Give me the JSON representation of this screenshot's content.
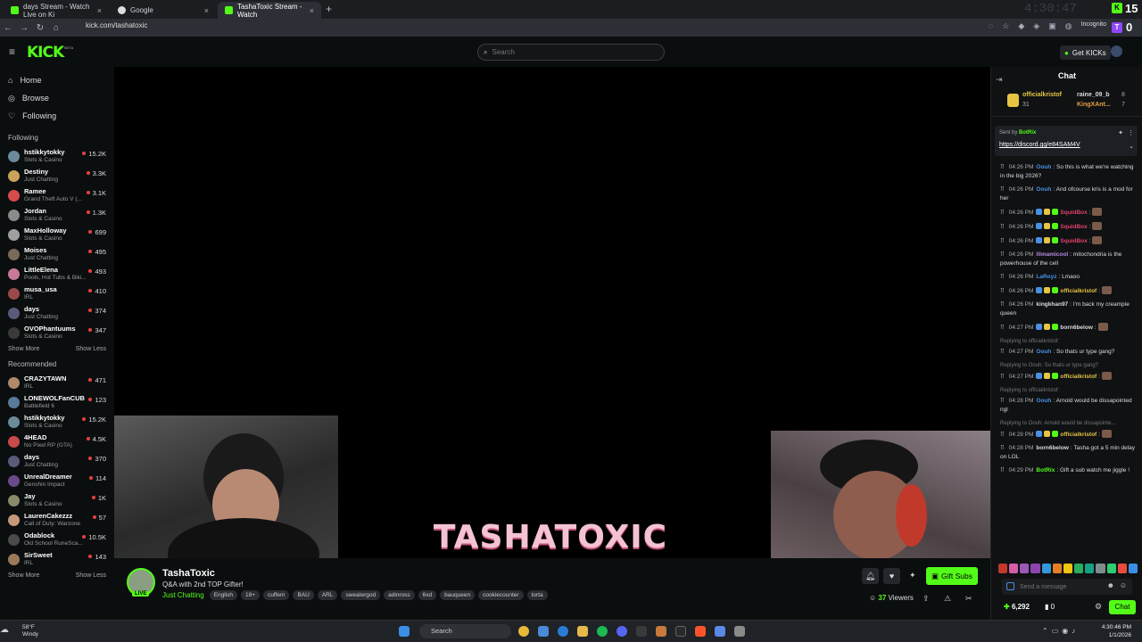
{
  "browser": {
    "tabs": [
      {
        "title": "days Stream - Watch Live on Ki"
      },
      {
        "title": "Google"
      },
      {
        "title": "TashaToxic Stream - Watch"
      }
    ],
    "url": "kick.com/tashatoxic",
    "incognito": "Incognito"
  },
  "overlay": {
    "clock": "4:30:47",
    "badge1": "15",
    "badge2": "0"
  },
  "header": {
    "logo": "KICK",
    "beta": "BETA",
    "search_placeholder": "Search",
    "get_kicks": "Get KICKs"
  },
  "sidebar": {
    "nav": [
      {
        "label": "Home"
      },
      {
        "label": "Browse"
      },
      {
        "label": "Following"
      }
    ],
    "following_title": "Following",
    "following": [
      {
        "name": "hstikkytokky",
        "cat": "Slots & Casino",
        "viewers": "15.2K",
        "color": "#6b8a9a"
      },
      {
        "name": "Destiny",
        "cat": "Just Chatting",
        "viewers": "3.3K",
        "color": "#c9a35a"
      },
      {
        "name": "Ramee",
        "cat": "Grand Theft Auto V (...",
        "viewers": "3.1K",
        "color": "#d84b4b"
      },
      {
        "name": "Jordan",
        "cat": "Slots & Casino",
        "viewers": "1.3K",
        "color": "#8a8a8a"
      },
      {
        "name": "MaxHolloway",
        "cat": "Slots & Casino",
        "viewers": "699",
        "color": "#a0a0a0"
      },
      {
        "name": "Moises",
        "cat": "Just Chatting",
        "viewers": "495",
        "color": "#7a6a5a"
      },
      {
        "name": "LittleElena",
        "cat": "Pools, Hot Tubs & Biki...",
        "viewers": "493",
        "color": "#c77a9a"
      },
      {
        "name": "musa_usa",
        "cat": "IRL",
        "viewers": "410",
        "color": "#9a4a4a"
      },
      {
        "name": "days",
        "cat": "Just Chatting",
        "viewers": "374",
        "color": "#5a5a7a"
      },
      {
        "name": "OVOPhantuums",
        "cat": "Slots & Casino",
        "viewers": "347",
        "color": "#3a3a3a"
      }
    ],
    "show_more": "Show More",
    "show_less": "Show Less",
    "recommended_title": "Recommended",
    "recommended": [
      {
        "name": "CRAZYTAWN",
        "cat": "IRL",
        "viewers": "471",
        "color": "#b08a6a"
      },
      {
        "name": "LONEWOLFanCUB",
        "cat": "Battlefield 6",
        "viewers": "123",
        "color": "#5a7a9a"
      },
      {
        "name": "hstikkytokky",
        "cat": "Slots & Casino",
        "viewers": "15.2K",
        "color": "#6b8a9a"
      },
      {
        "name": "4HEAD",
        "cat": "No Pixel RP (GTA)",
        "viewers": "4.5K",
        "color": "#c84a4a"
      },
      {
        "name": "days",
        "cat": "Just Chatting",
        "viewers": "370",
        "color": "#5a5a7a"
      },
      {
        "name": "UnrealDreamer",
        "cat": "Genshin Impact",
        "viewers": "114",
        "color": "#6a4a8a"
      },
      {
        "name": "Jay",
        "cat": "Slots & Casino",
        "viewers": "1K",
        "color": "#8a8a6a"
      },
      {
        "name": "LaurenCakezzz",
        "cat": "Call of Duty: Warzone",
        "viewers": "57",
        "color": "#c49a7a"
      },
      {
        "name": "Odablock",
        "cat": "Old School RuneSca...",
        "viewers": "10.5K",
        "color": "#4a4a4a"
      },
      {
        "name": "SirSweet",
        "cat": "IRL",
        "viewers": "143",
        "color": "#9a7a5a"
      }
    ]
  },
  "stream": {
    "overlay_text": "TASHATOXIC",
    "name": "TashaToxic",
    "live": "LIVE",
    "title": "Q&A with 2nd TOP Gifter!",
    "category": "Just Chatting",
    "tags": [
      "English",
      "18+",
      "cuffem",
      "BAU",
      "ARL",
      "sweatergod",
      "adinross",
      "6xd",
      "bauqueen",
      "cookiecounter",
      "torta"
    ],
    "gift_subs": "Gift Subs",
    "viewers_count": "37",
    "viewers_label": "Viewers"
  },
  "chat": {
    "title": "Chat",
    "leaderboard": [
      {
        "name": "officialkristof",
        "count": "31"
      },
      {
        "name": "raine_09_b",
        "count": "8"
      },
      {
        "name": "KingXAnt...",
        "count": "7"
      }
    ],
    "pinned_sender": "Sent by",
    "pinned_bot": "BotRix",
    "pinned_link": "https://discord.gg/e84SAM4V",
    "messages": [
      {
        "time": "04:26 PM",
        "user": "Oouh",
        "color": "#4a90e2",
        "text": "So this is what we're watching in the big 2026?"
      },
      {
        "time": "04:26 PM",
        "user": "Oouh",
        "color": "#4a90e2",
        "text": "And ofcourse kris is a mod for her"
      },
      {
        "time": "04:26 PM",
        "user": "SquidBox",
        "color": "#e0426a",
        "text": ""
      },
      {
        "time": "04:26 PM",
        "user": "SquidBox",
        "color": "#e0426a",
        "text": ""
      },
      {
        "time": "04:26 PM",
        "user": "SquidBox",
        "color": "#e0426a",
        "text": ""
      },
      {
        "time": "04:26 PM",
        "user": "lilmamicool",
        "color": "#b48ae0",
        "text": "mitochondria is the powerhouse of the cell"
      },
      {
        "time": "04:26 PM",
        "user": "LaRoyz",
        "color": "#4a90e2",
        "text": "Lmaoo"
      },
      {
        "time": "04:26 PM",
        "user": "officialkristof",
        "color": "#e6c542",
        "text": ""
      },
      {
        "time": "04:26 PM",
        "user": "kingkhan97",
        "color": "#ddd",
        "text": "I'm back my creampie queen"
      },
      {
        "time": "04:27 PM",
        "user": "born6below",
        "color": "#ddd",
        "text": ""
      },
      {
        "reply": "Replying to officialkristof:",
        "time": "04:27 PM",
        "user": "Oouh",
        "color": "#4a90e2",
        "text": "So thats ur type gang?"
      },
      {
        "reply": "Replying to Oouh: So thats ur type gang?",
        "time": "04:27 PM",
        "user": "officialkristof",
        "color": "#e6c542",
        "text": ""
      },
      {
        "reply": "Replying to officialkristof:",
        "time": "04:28 PM",
        "user": "Oouh",
        "color": "#4a90e2",
        "text": "Arnold would be dissapointed ngl"
      },
      {
        "reply": "Replying to Oouh: Arnold would be dissapointe...",
        "time": "04:28 PM",
        "user": "officialkristof",
        "color": "#e6c542",
        "text": ""
      },
      {
        "time": "04:28 PM",
        "user": "born6below",
        "color": "#ddd",
        "text": "Tasha got a 5 min delay on LOL"
      },
      {
        "time": "04:29 PM",
        "user": "BotRix",
        "color": "#53fc18",
        "text": "Gift a sub watch me jiggle !"
      }
    ],
    "input_placeholder": "Send a message",
    "points": "6,292",
    "zero": "0",
    "chat_button": "Chat"
  },
  "taskbar": {
    "temp": "58°F",
    "weather": "Windy",
    "search": "Search",
    "time": "4:30:46 PM",
    "date": "1/1/2026"
  }
}
